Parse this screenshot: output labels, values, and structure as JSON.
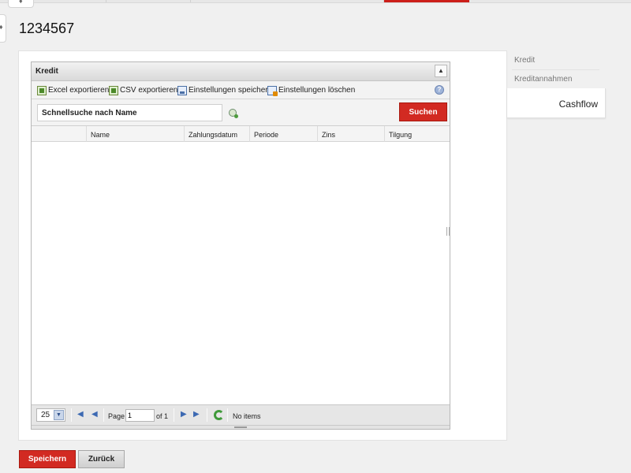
{
  "header": {
    "title": "1234567"
  },
  "grid": {
    "title": "Kredit",
    "toolbar": {
      "excel": "Excel exportieren",
      "csv": "CSV exportieren",
      "save_settings": "Einstellungen speichern",
      "delete_settings": "Einstellungen löschen"
    },
    "search": {
      "placeholder": "Schnellsuche nach Name",
      "button": "Suchen"
    },
    "columns": [
      "",
      "Name",
      "Zahlungsdatum",
      "Periode",
      "Zins",
      "Tilgung"
    ],
    "rows": [],
    "pager": {
      "page_size": "25",
      "page_label": "Page",
      "current_page": "1",
      "of_label": "of 1",
      "status": "No items"
    }
  },
  "sidenav": {
    "items": [
      {
        "label": "Kredit",
        "active": false
      },
      {
        "label": "Kreditannahmen",
        "active": false
      },
      {
        "label": "Cashflow",
        "active": true
      }
    ]
  },
  "footer": {
    "save": "Speichern",
    "back": "Zurück"
  },
  "colors": {
    "accent": "#d22a22",
    "background": "#f0f0f0"
  },
  "icons": {
    "excel": "excel-icon",
    "csv": "csv-icon",
    "save_settings": "save-settings-icon",
    "delete_settings": "delete-settings-icon",
    "help": "help-icon",
    "refresh": "refresh-icon"
  }
}
